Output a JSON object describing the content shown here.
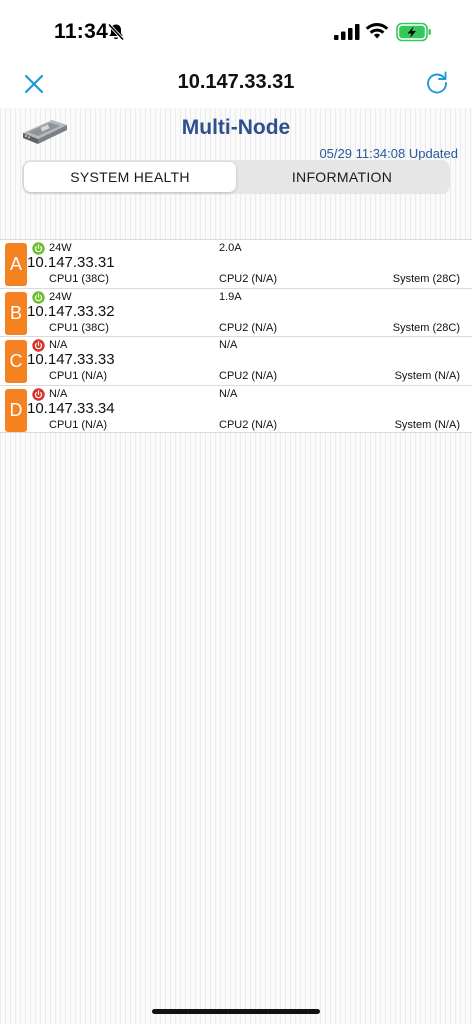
{
  "status": {
    "time": "11:34"
  },
  "nav": {
    "title": "10.147.33.31"
  },
  "header": {
    "title": "Multi-Node",
    "updated": "05/29 11:34:08 Updated"
  },
  "tabs": [
    {
      "label": "SYSTEM HEALTH",
      "active": true
    },
    {
      "label": "INFORMATION",
      "active": false
    }
  ],
  "nodes": [
    {
      "letter": "A",
      "power_state": "on",
      "power": "24W",
      "current": "2.0A",
      "ip": "10.147.33.31",
      "cpu1": "CPU1 (38C)",
      "cpu2": "CPU2 (N/A)",
      "system": "System (28C)"
    },
    {
      "letter": "B",
      "power_state": "on",
      "power": "24W",
      "current": "1.9A",
      "ip": "10.147.33.32",
      "cpu1": "CPU1 (38C)",
      "cpu2": "CPU2 (N/A)",
      "system": "System (28C)"
    },
    {
      "letter": "C",
      "power_state": "off",
      "power": "N/A",
      "current": "N/A",
      "ip": "10.147.33.33",
      "cpu1": "CPU1 (N/A)",
      "cpu2": "CPU2 (N/A)",
      "system": "System (N/A)"
    },
    {
      "letter": "D",
      "power_state": "off",
      "power": "N/A",
      "current": "N/A",
      "ip": "10.147.33.34",
      "cpu1": "CPU1 (N/A)",
      "cpu2": "CPU2 (N/A)",
      "system": "System (N/A)"
    }
  ],
  "icons": {
    "close": "close-icon",
    "refresh": "refresh-icon",
    "server": "server-icon",
    "power_on": "power-on-icon",
    "power_off": "power-off-icon"
  },
  "colors": {
    "accent": "#1e9bd7",
    "title": "#2f4f8f",
    "updated": "#2a5a9a",
    "badge": "#f58220",
    "power_on": "#6cbf2a",
    "power_off": "#d9342b",
    "battery": "#35c759"
  }
}
